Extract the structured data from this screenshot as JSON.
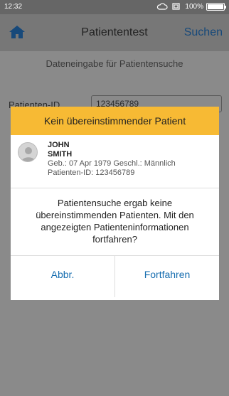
{
  "status": {
    "time": "12:32",
    "battery": "100%"
  },
  "nav": {
    "title": "Patiententest",
    "search_label": "Suchen"
  },
  "form": {
    "section_title": "Dateneingabe für Patientensuche",
    "patient_id_label": "Patienten-ID",
    "patient_id_value": "123456789"
  },
  "dialog": {
    "title": "Kein übereinstimmender Patient",
    "patient": {
      "first_name": "JOHN",
      "last_name": "SMITH",
      "meta": "Geb.: 07 Apr 1979   Geschl.: Männlich",
      "patient_id": "Patienten-ID: 123456789"
    },
    "message": "Patientensuche ergab keine übereinstimmenden Patienten. Mit den angezeigten Patienteninformationen fortfahren?",
    "cancel_label": "Abbr.",
    "continue_label": "Fortfahren"
  },
  "colors": {
    "accent": "#f7ba34",
    "link": "#176eb0"
  }
}
